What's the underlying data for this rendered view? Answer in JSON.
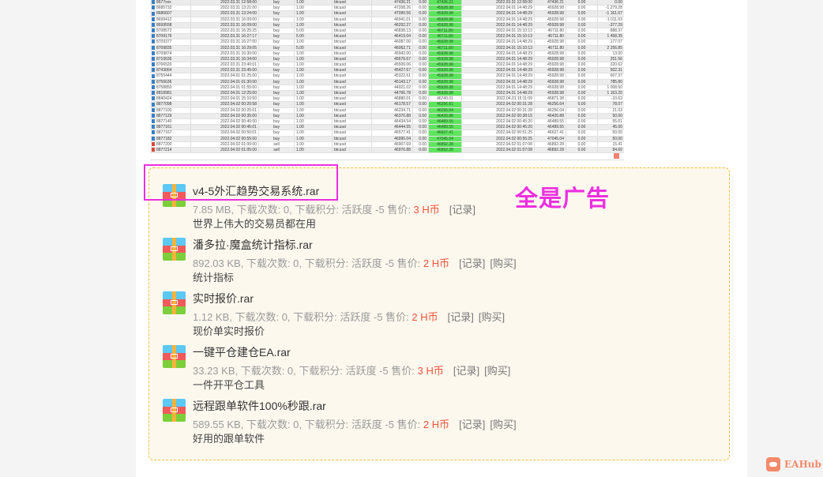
{
  "table": {
    "rows": [
      [
        "8677xxx",
        "2022.03.31 12:58:00",
        "buy",
        "1.00",
        "btcusd",
        "47436.21",
        "0.00",
        "47436.21",
        "2022.03.31 12:58:00",
        "47436.21",
        "0.00",
        "0.00",
        true,
        "buy"
      ],
      [
        "8685732",
        "2022.03.31 13:21:00",
        "buy",
        "1.00",
        "btcusd",
        "47208.26",
        "0.00",
        "45928.98",
        "2022.04.01 14:48:29",
        "45928.98",
        "0.00",
        "-1 279.28",
        true,
        "buy"
      ],
      [
        "8686607",
        "2022.03.31 13:24:00",
        "buy",
        "1.00",
        "btcusd",
        "47090.56",
        "0.00",
        "45928.98",
        "2022.04.01 14:48:29",
        "45928.98",
        "0.00",
        "-1 161.67",
        true,
        "buy"
      ],
      [
        "8699412",
        "2022.03.31 16:09:00",
        "buy",
        "1.00",
        "btcusd",
        "46941.01",
        "0.00",
        "45928.98",
        "2022.04.01 14:48:29",
        "45928.98",
        "0.00",
        "-1 011.03",
        true,
        "buy"
      ],
      [
        "8699558",
        "2022.03.31 16:09:00",
        "buy",
        "1.00",
        "btcusd",
        "46292.27",
        "0.00",
        "45928.98",
        "2022.04.01 14:48:29",
        "45928.98",
        "0.00",
        "-377.29",
        true,
        "buy"
      ],
      [
        "8708572",
        "2022.03.31 16:25:25",
        "buy",
        "5.00",
        "btcusd",
        "46838.13",
        "0.00",
        "46711.80",
        "2022.04.01 15:10:13",
        "46711.80",
        "0.00",
        "888.37",
        true,
        "buy"
      ],
      [
        "8709176",
        "2022.03.31 16:27:17",
        "buy",
        "5.00",
        "btcusd",
        "46419.04",
        "0.00",
        "46711.80",
        "2022.04.01 15:10:13",
        "46711.80",
        "0.00",
        "1 458.35",
        true,
        "buy"
      ],
      [
        "8709377",
        "2022.03.31 16:27:00",
        "buy",
        "1.00",
        "btcusd",
        "46087.00",
        "0.00",
        "45928.98",
        "2022.04.01 14:48:29",
        "45928.98",
        "0.00",
        "177.07",
        true,
        "buy"
      ],
      [
        "8709835",
        "2022.03.31 16:29:05",
        "buy",
        "5.00",
        "btcusd",
        "46062.71",
        "0.00",
        "46711.80",
        "2022.04.01 15:10:13",
        "46711.80",
        "0.00",
        "2 256.85",
        true,
        "buy"
      ],
      [
        "8709874",
        "2022.03.31 16:30:00",
        "buy",
        "1.00",
        "btcusd",
        "45942.00",
        "0.00",
        "45928.98",
        "2022.04.01 14:48:29",
        "45928.98",
        "0.00",
        "13.00",
        true,
        "buy"
      ],
      [
        "8710636",
        "2022.03.31 16:34:00",
        "buy",
        "1.00",
        "btcusd",
        "45676.67",
        "0.00",
        "45928.98",
        "2022.04.01 14:48:29",
        "45928.98",
        "0.00",
        "251.56",
        true,
        "buy"
      ],
      [
        "8766520",
        "2022.03.31 23:40:01",
        "buy",
        "1.00",
        "btcusd",
        "45509.06",
        "0.00",
        "45928.98",
        "2022.04.01 14:48:29",
        "45928.98",
        "0.00",
        "320.62",
        true,
        "buy"
      ],
      [
        "8743064",
        "2022.03.31 23:45:00",
        "buy",
        "1.00",
        "btcusd",
        "45427.67",
        "0.00",
        "45928.98",
        "2022.04.01 14:48:29",
        "45928.98",
        "0.00",
        "502.31",
        true,
        "buy"
      ],
      [
        "8755444",
        "2022.04.01 01:25:00",
        "buy",
        "1.00",
        "btcusd",
        "45322.61",
        "0.00",
        "45928.98",
        "2022.04.01 14:48:29",
        "45928.98",
        "0.00",
        "607.37",
        true,
        "buy"
      ],
      [
        "8756636",
        "2022.04.01 01:30:00",
        "buy",
        "1.00",
        "btcusd",
        "45143.17",
        "0.00",
        "45928.98",
        "2022.04.01 14:48:29",
        "45928.98",
        "0.00",
        "785.80",
        true,
        "buy"
      ],
      [
        "8758850",
        "2022.04.01 01:55:00",
        "buy",
        "1.00",
        "btcusd",
        "44921.02",
        "0.00",
        "45928.98",
        "2022.04.01 14:48:29",
        "45928.98",
        "0.00",
        "1 008.50",
        true,
        "buy"
      ],
      [
        "8818981",
        "2022.04.01 12:25:00",
        "buy",
        "1.00",
        "btcusd",
        "44766.78",
        "0.00",
        "45928.98",
        "2022.04.01 14:48:29",
        "45928.98",
        "0.00",
        "1 163.20",
        true,
        "buy"
      ],
      [
        "8840424",
        "2022.04.01 15:10:50",
        "buy",
        "1.00",
        "btcusd",
        "46880.01",
        "0.00",
        "46740.01",
        "2022.04.01 15:11:09",
        "46871.38",
        "0.00",
        "-10.63",
        false,
        "buy"
      ],
      [
        "8877098",
        "2022.04.02 00:20:58",
        "buy",
        "1.00",
        "btcusd",
        "46178.57",
        "0.00",
        "46256.61",
        "2022.04.02 00:31:28",
        "46256.64",
        "0.00",
        "78.07",
        true,
        "buy"
      ],
      [
        "8877100",
        "2022.04.02 00:25:01",
        "buy",
        "1.00",
        "btcusd",
        "46234.71",
        "0.00",
        "46256.04",
        "2022.04.02 00:31:28",
        "46256.04",
        "0.00",
        "21.03",
        true,
        "buy"
      ],
      [
        "8877129",
        "2022.04.02 00:35:00",
        "buy",
        "1.00",
        "btcusd",
        "46370.88",
        "0.00",
        "46420.88",
        "2022.04.02 00:38:15",
        "46420.88",
        "0.00",
        "50.00",
        true,
        "buy"
      ],
      [
        "8877140",
        "2022.04.02 00:40:00",
        "buy",
        "1.00",
        "btcusd",
        "46434.54",
        "0.00",
        "46489.55",
        "2022.04.02 00:45:20",
        "46489.55",
        "0.00",
        "55.01",
        true,
        "buy"
      ],
      [
        "8877161",
        "2022.04.02 00:45:01",
        "buy",
        "1.00",
        "btcusd",
        "46444.55",
        "0.00",
        "46489.55",
        "2022.04.02 00:45:20",
        "46489.55",
        "0.00",
        "45.00",
        true,
        "buy"
      ],
      [
        "8877167",
        "2022.04.02 00:50:01",
        "buy",
        "1.00",
        "btcusd",
        "46577.41",
        "0.00",
        "46627.41",
        "2022.04.02 00:51:25",
        "46627.41",
        "0.00",
        "50.00",
        true,
        "buy"
      ],
      [
        "8877182",
        "2022.04.02 00:55:00",
        "buy",
        "1.00",
        "btcusd",
        "46995.04",
        "0.00",
        "47045.04",
        "2022.04.02 00:55:25",
        "47045.04",
        "0.00",
        "50.00",
        true,
        "buy"
      ],
      [
        "8877200",
        "2022.04.02 01:00:00",
        "sell",
        "1.00",
        "btcusd",
        "46907.69",
        "0.00",
        "46892.28",
        "2022.04.02 01:07:08",
        "46892.28",
        "0.00",
        "15.41",
        true,
        "sell"
      ],
      [
        "8877214",
        "2022.04.02 01:05:00",
        "sell",
        "1.00",
        "btcusd",
        "46976.88",
        "0.00",
        "46892.28",
        "2022.04.02 01:07:08",
        "46892.28",
        "0.00",
        "84.60",
        true,
        "sell"
      ]
    ]
  },
  "annotation": {
    "text": "全是广告"
  },
  "files": [
    {
      "title": "v4-5外汇趋势交易系统.rar",
      "meta": "7.85 MB, 下载次数: 0, 下载积分: 活跃度 -5 售价: ",
      "price": "3 H币",
      "record": "[记录]",
      "buy": "",
      "desc": "世界上伟大的交易员都在用"
    },
    {
      "title": "潘多拉·魔盒统计指标.rar",
      "meta": "892.03 KB, 下载次数: 0, 下载积分: 活跃度 -5 售价: ",
      "price": "2 H币",
      "record": "[记录]",
      "buy": "[购买]",
      "desc": "统计指标"
    },
    {
      "title": "实时报价.rar",
      "meta": "1.12 KB, 下载次数: 0, 下载积分: 活跃度 -5 售价: ",
      "price": "2 H币",
      "record": "[记录]",
      "buy": "[购买]",
      "desc": "现价单实时报价"
    },
    {
      "title": "一键平仓建仓EA.rar",
      "meta": "33.23 KB, 下载次数: 0, 下载积分: 活跃度 -5 售价: ",
      "price": "3 H币",
      "record": "[记录]",
      "buy": "[购买]",
      "desc": "一件开平仓工具"
    },
    {
      "title": "远程跟单软件100%秒跟.rar",
      "meta": "589.55 KB, 下载次数: 0, 下载积分: 活跃度 -5 售价: ",
      "price": "2 H币",
      "record": "[记录]",
      "buy": "[购买]",
      "desc": "好用的跟单软件"
    }
  ],
  "brand": {
    "name": "EAHub"
  },
  "colors": {
    "price": "#f2553c",
    "highlight": "#ec2fe0",
    "green_cell": "#5de55d"
  }
}
